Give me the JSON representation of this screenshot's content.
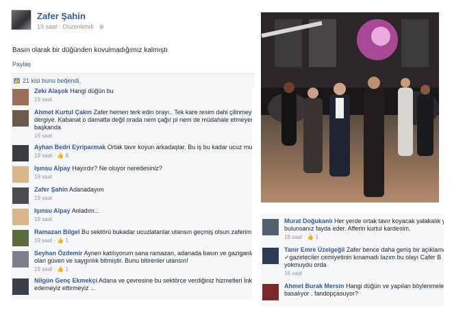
{
  "post": {
    "author": "Zafer Şahin",
    "meta": "19 saat · Düzenlendi · ",
    "privacy_icon": "globe-icon",
    "text": "Basın olarak bir düğünden kovulmadığımız kalmıştı",
    "share_label": "Paylaş",
    "likes_text": "21 kişi bunu beğendi."
  },
  "comments_left": [
    {
      "name": "Zeki Alaşok",
      "text": "Hangi düğün bu",
      "meta": "19 saat",
      "avatar_color": "#9b6f5a"
    },
    {
      "name": "Ahmet Kurtul Çakın",
      "text": "Zafer hemen terk edin orayı.. Tek kare resim dahi çilinmeyecek, dergiye. Kabanat o damatta değil orada nem çağır pi nem de müdahale etmeyen başkanda",
      "meta": "19 saat",
      "avatar_color": "#6e5a4a",
      "lines": [
        "Zafer hemen terk edin orayı.. Tek kare resim dahi çilinmeyecek,",
        "dergiye. Kabanat o damatta değil orada nem çağır pi nem de müdahale etmeyen",
        "başkanda"
      ]
    },
    {
      "name": "Ayhan Bedri Eyriparmak",
      "text": "Ortak tavır koyun arkadaşlar. Bu iş bu kadar ucuz mu?",
      "meta": "19 saat · 👍 8",
      "avatar_color": "#3b3d44"
    },
    {
      "name": "Işınsu Alpay",
      "text": "Hayırdır? Ne oluyor neredesiniz?",
      "meta": "19 saat",
      "avatar_color": "#d9b58a"
    },
    {
      "name": "Zafer Şahin",
      "text": "Adanadayım",
      "meta": "19 saat",
      "avatar_color": "#4a4c52"
    },
    {
      "name": "Işınsu Alpay",
      "text": "Anladım...",
      "meta": "19 saat",
      "avatar_color": "#d9b58a"
    },
    {
      "name": "Ramazan Bilgel",
      "text": "Bu sektörü bukadar ucuzlatanlar utansın geçmiş olsun zaferim",
      "meta": "19 saat · 👍 1",
      "avatar_color": "#5a6b3e"
    },
    {
      "name": "Seyhan Özdemir",
      "text": "Aynen katılıyorum sana ramazan, adanada basın ve gaziganlara olan güven ve saygınlık bitmiştir. Bunu bitirenler utansın!",
      "meta": "19 saat · 👍 1",
      "avatar_color": "#7a7f88",
      "lines": [
        "Aynen katılıyorum sana ramazan, adanada basın ve gaziganlara",
        "olan güven ve saygınlık bitmiştir. Bunu bitirenler utansın!"
      ]
    },
    {
      "name": "Nilgün Genç Ekmekçi",
      "text": "Adana ve çevresine bu sektörce verdiğiniz hizmetleri İnkar edemeyiz ettirmeyiz ...",
      "meta": "",
      "avatar_color": "#3c3f4a",
      "lines": [
        "Adana ve çevresine bu sektörce verdiğiniz hizmetleri İnkar",
        "edemeyiz ettirmeyiz ..."
      ]
    }
  ],
  "comments_right": [
    {
      "name": "Murat Doğukanlı",
      "lines": [
        "Her yerde ortak tavır koyacak yalakalık yapmıyo",
        "bulunsanız fayda eder. Afferin kurtul kardesim."
      ],
      "meta": "16 saat · 👍 1",
      "avatar_color": "#55606e"
    },
    {
      "name": "Tanır Emre Üzelgeğil",
      "lines": [
        "Zafer bence daha geniş bir açıklama",
        "✓gazeteciler cemiyetinin kınamadı lazım bu olayı Cafer B",
        "yokmuydu orda"
      ],
      "meta": "16 saat",
      "avatar_color": "#2f3a55"
    },
    {
      "name": "Ahmet Burak Mersin",
      "lines": [
        "Hangi düğün ve yapılan böylenmeler",
        "basalıyor . fandopçasuyor?"
      ],
      "meta": "",
      "avatar_color": "#7a2a2a"
    }
  ],
  "colors": {
    "link": "#365899",
    "meta": "#90949c",
    "bg_comment": "#f6f7f9",
    "like": "#5890ff"
  }
}
